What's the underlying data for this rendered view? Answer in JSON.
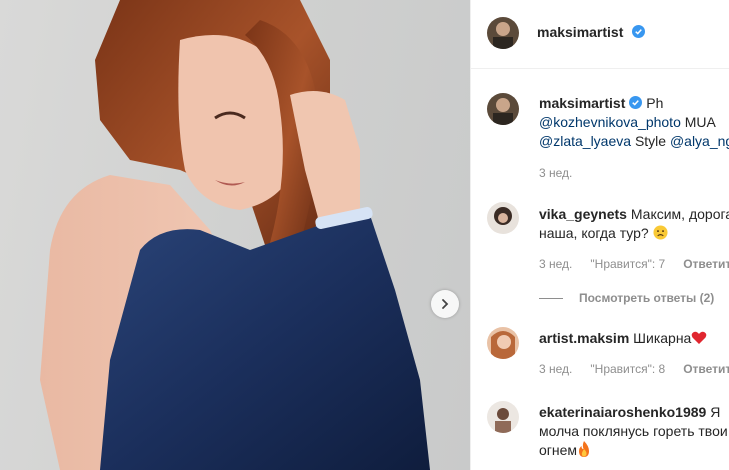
{
  "post": {
    "author": "maksimartist",
    "verified": true,
    "caption_prefix": "Ph",
    "caption_handle1": "@kozhevnikova_photo",
    "caption_mua": "MUA",
    "caption_handle2": "@zlata_lyaeva",
    "caption_style": "Style",
    "caption_handle3": "@alya_ngu",
    "time": "3 нед."
  },
  "comments": [
    {
      "user": "vika_geynets",
      "text_line1": "Максим, дорога",
      "text_line2": "наша, когда тур?",
      "emoji": "disappointed-face",
      "time": "3 нед.",
      "likes": "\"Нравится\": 7",
      "reply": "Ответить",
      "view_replies": "Посмотреть ответы (2)"
    },
    {
      "user": "artist.maksim",
      "text_line1": "Шикарна",
      "emoji": "red-heart",
      "time": "3 нед.",
      "likes": "\"Нравится\": 8",
      "reply": "Ответить"
    },
    {
      "user": "ekaterinaiaroshenko1989",
      "text_line1": "Я",
      "text_line2": "молча поклянусь гореть твои",
      "text_line3": "огнем",
      "emoji": "fire"
    }
  ],
  "colors": {
    "verified_blue": "#3897f0",
    "link": "#00376b",
    "meta_gray": "#8e8e8e",
    "dress_blue": "#1b2f5c"
  },
  "icons": [
    "verified-badge-icon",
    "chevron-right-icon",
    "disappointed-face-emoji",
    "red-heart-emoji",
    "fire-emoji"
  ]
}
